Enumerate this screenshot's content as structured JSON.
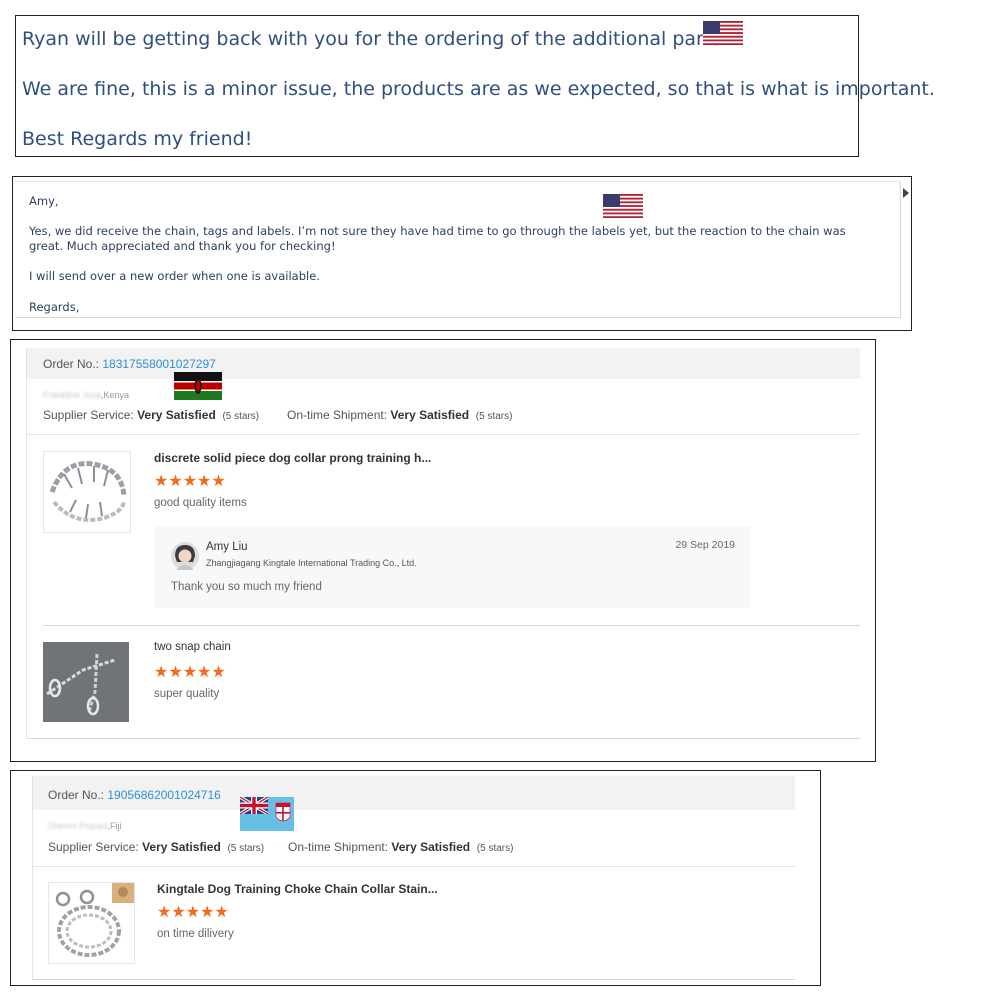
{
  "panel1": {
    "line1": "Ryan will be getting back with you for the ordering of the additional parts.",
    "line2": "We are fine, this is a minor issue, the products are as we expected, so that is what is important.",
    "line3": "Best Regards my friend!",
    "flag_icon": "us-flag-icon"
  },
  "panel2": {
    "greeting": "Amy,",
    "para1a": "Yes, we did receive the chain, tags and labels. I’m not sure they have had time to go through the labels yet, but the reaction to the chain was",
    "para1b": "great. Much appreciated and thank you for checking!",
    "para2": "I will send over a new order when one is available.",
    "closing": "Regards,",
    "flag_icon": "us-flag-icon"
  },
  "order1": {
    "order_label": "Order No.:",
    "order_number": "18317558001027297",
    "buyer_blurred": "Frankline Jcca",
    "buyer_country": ",Kenya",
    "flag_icon": "kenya-flag-icon",
    "supplier_service_label": "Supplier Service:",
    "supplier_service_value": "Very Satisfied",
    "supplier_service_stars": "(5 stars)",
    "shipment_label": "On-time Shipment:",
    "shipment_value": "Very Satisfied",
    "shipment_stars": "(5 stars)",
    "items": [
      {
        "title": "discrete solid piece dog collar prong training h...",
        "rating": 5,
        "stars": "★★★★★",
        "review": "good quality items",
        "thumb_icon": "prong-collar-image"
      },
      {
        "title": "two snap chain",
        "rating": 5,
        "stars": "★★★★★",
        "review": "super quality",
        "thumb_icon": "snap-chain-image"
      }
    ],
    "reply": {
      "name": "Amy Liu",
      "company": "Zhangjiagang Kingtale International Trading Co., Ltd.",
      "date": "29 Sep 2019",
      "message": "Thank you so much my friend",
      "avatar_icon": "avatar"
    }
  },
  "order2": {
    "order_label": "Order No.:",
    "order_number": "19056862001024716",
    "buyer_blurred": "Dhenni Prasad",
    "buyer_country": ",Fiji",
    "flag_icons": [
      "uk-flag-icon",
      "fiji-flag-icon"
    ],
    "supplier_service_label": "Supplier Service:",
    "supplier_service_value": "Very Satisfied",
    "supplier_service_stars": "(5 stars)",
    "shipment_label": "On-time Shipment:",
    "shipment_value": "Very Satisfied",
    "shipment_stars": "(5 stars)",
    "items": [
      {
        "title": "Kingtale Dog Training Choke Chain Collar Stain...",
        "rating": 5,
        "stars": "★★★★★",
        "review": "on time dilivery",
        "thumb_icon": "choke-chain-image"
      }
    ]
  },
  "colors": {
    "star": "#f26b1d",
    "order_number": "#2f8fd1",
    "email_text": "#2f4f7f"
  }
}
